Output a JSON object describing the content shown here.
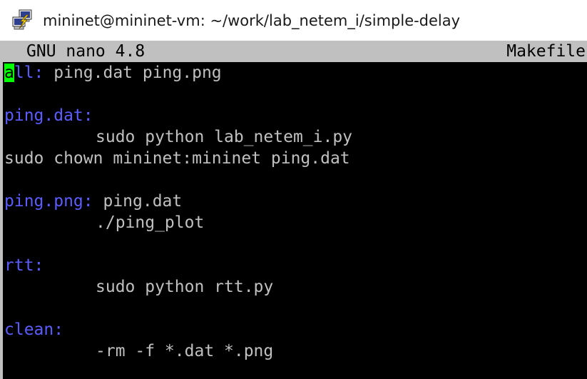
{
  "window": {
    "title": "mininet@mininet-vm: ~/work/lab_netem_i/simple-delay",
    "icon": "putty-terminal-icon"
  },
  "nano": {
    "version": "GNU nano 4.8",
    "filename": "Makefile"
  },
  "colors": {
    "terminal_bg": "#000000",
    "text": "#c0c0c0",
    "target": "#5c5cff",
    "header_bg": "#c0c0c0",
    "cursor": "#00ff00"
  },
  "lines": [
    {
      "cursor_char": "a",
      "target_rest": "ll:",
      "prereq": " ping.dat ping.png"
    },
    {
      "target": "ping.dat:"
    },
    {
      "command": "sudo python lab_netem_i.py"
    },
    {
      "text": "sudo chown mininet:mininet ping.dat"
    },
    {
      "target": "ping.png:",
      "prereq": " ping.dat"
    },
    {
      "command": "./ping_plot"
    },
    {
      "target": "rtt:"
    },
    {
      "command": "sudo python rtt.py"
    },
    {
      "target": "clean:"
    },
    {
      "command": "-rm -f *.dat *.png"
    }
  ]
}
